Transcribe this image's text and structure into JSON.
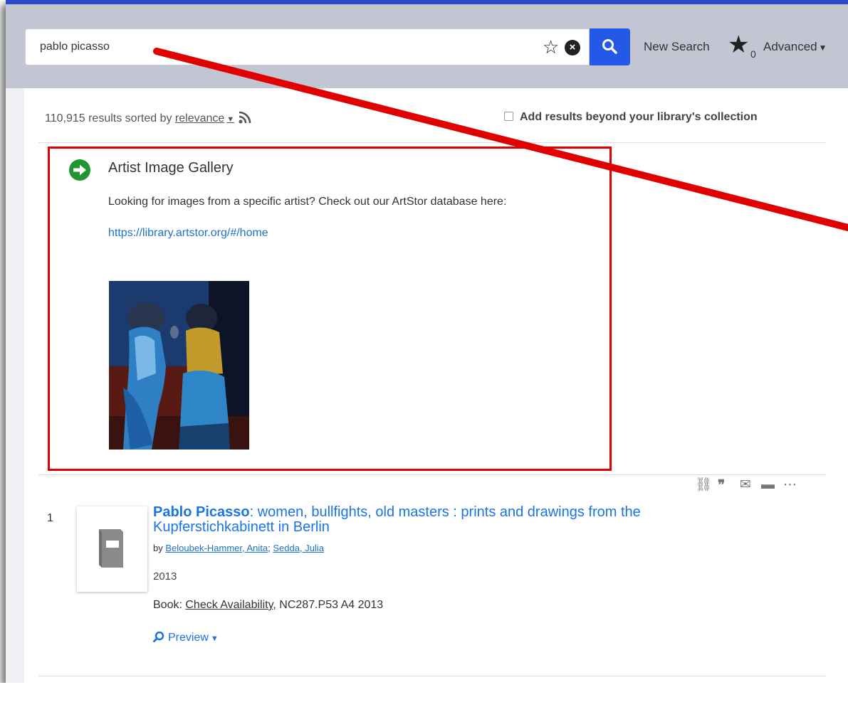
{
  "search": {
    "query": "pablo picasso",
    "clear_glyph": "×",
    "new_search_label": "New Search",
    "saved_count": "0",
    "advanced_label": "Advanced"
  },
  "results": {
    "summary_prefix": "110,915 results sorted by ",
    "sort_label": "relevance",
    "beyond_label": "Add results beyond your library's collection"
  },
  "gallery": {
    "title": "Artist Image Gallery",
    "text": "Looking for images from a specific artist? Check out our ArtStor database here:",
    "link": "https://library.artstor.org/#/home"
  },
  "result_1": {
    "number": "1",
    "title_bold": "Pablo Picasso",
    "title_rest": ": women, bullfights, old masters : prints and drawings from the Kupferstichkabinett in Berlin",
    "by_label": "by ",
    "author_1": "Beloubek-Hammer, Anita",
    "author_sep": "; ",
    "author_2": "Sedda, Julia",
    "year": "2013",
    "format_label": "Book: ",
    "availability_label": "Check Availability",
    "call_number": ", NC287.P53 A4 2013",
    "preview_label": "Preview"
  },
  "icons": {
    "star_outline": "star-outline-icon",
    "clear": "clear-icon",
    "search": "search-icon",
    "saved_star": "star-icon",
    "rss": "rss-icon",
    "arrow": "arrow-right-circle-icon",
    "link": "link-icon",
    "quote": "quote-icon",
    "email": "email-icon",
    "folder": "folder-add-icon",
    "more": "more-icon",
    "preview": "magnify-icon"
  },
  "colors": {
    "accent_bar": "#2d49c8",
    "search_button": "#2458e6",
    "link_blue": "#1a73e8",
    "annotation_red": "#e00000",
    "arrow_green": "#1f9632"
  }
}
